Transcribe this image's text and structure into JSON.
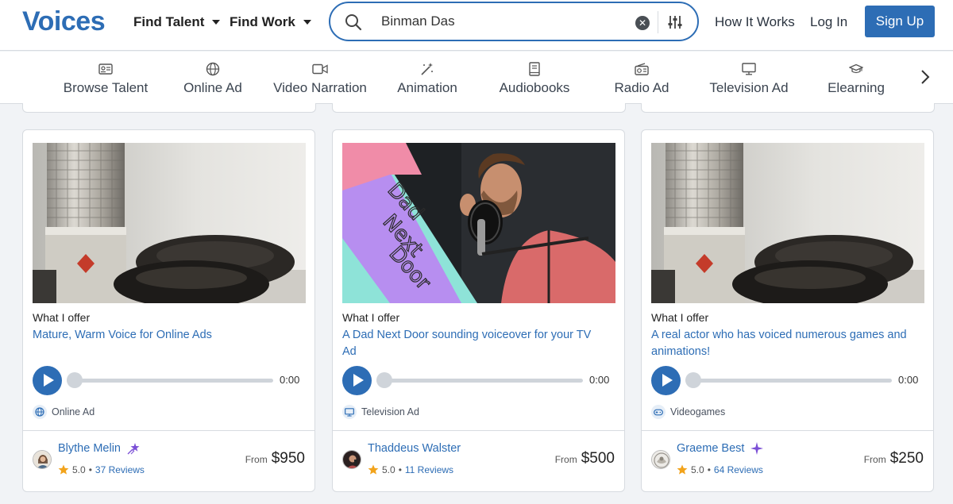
{
  "brand": {
    "logo": "Voices",
    "accent": "#2d6db5"
  },
  "header": {
    "find_talent": "Find Talent",
    "find_work": "Find Work",
    "search_value": "Binman Das",
    "how_it_works": "How It Works",
    "log_in": "Log In",
    "sign_up": "Sign Up"
  },
  "categories": [
    {
      "label": "Browse Talent",
      "icon": "id-card-icon"
    },
    {
      "label": "Online Ad",
      "icon": "globe-icon"
    },
    {
      "label": "Video Narration",
      "icon": "video-camera-icon"
    },
    {
      "label": "Animation",
      "icon": "magic-wand-icon"
    },
    {
      "label": "Audiobooks",
      "icon": "book-icon"
    },
    {
      "label": "Radio Ad",
      "icon": "radio-icon"
    },
    {
      "label": "Television Ad",
      "icon": "monitor-icon"
    },
    {
      "label": "Elearning",
      "icon": "graduation-cap-icon"
    }
  ],
  "cards": [
    {
      "offer_heading": "What I offer",
      "offer_title": "Mature, Warm Voice for Online Ads",
      "time": "0:00",
      "tag": "Online Ad",
      "tag_icon": "globe-icon",
      "name": "Blythe Melin",
      "rating": "5.0",
      "reviews": "37 Reviews",
      "from_label": "From",
      "price": "$950"
    },
    {
      "offer_heading": "What I offer",
      "offer_title": "A Dad Next Door sounding voiceover for your TV Ad",
      "thumb_text": [
        "Dad",
        "Next",
        "Door"
      ],
      "time": "0:00",
      "tag": "Television Ad",
      "tag_icon": "monitor-icon",
      "name": "Thaddeus Walster",
      "rating": "5.0",
      "reviews": "11 Reviews",
      "from_label": "From",
      "price": "$500"
    },
    {
      "offer_heading": "What I offer",
      "offer_title": "A real actor who has voiced numerous games and animations!",
      "time": "0:00",
      "tag": "Videogames",
      "tag_icon": "gamepad-icon",
      "name": "Graeme Best",
      "rating": "5.0",
      "reviews": "64 Reviews",
      "from_label": "From",
      "price": "$250"
    }
  ]
}
